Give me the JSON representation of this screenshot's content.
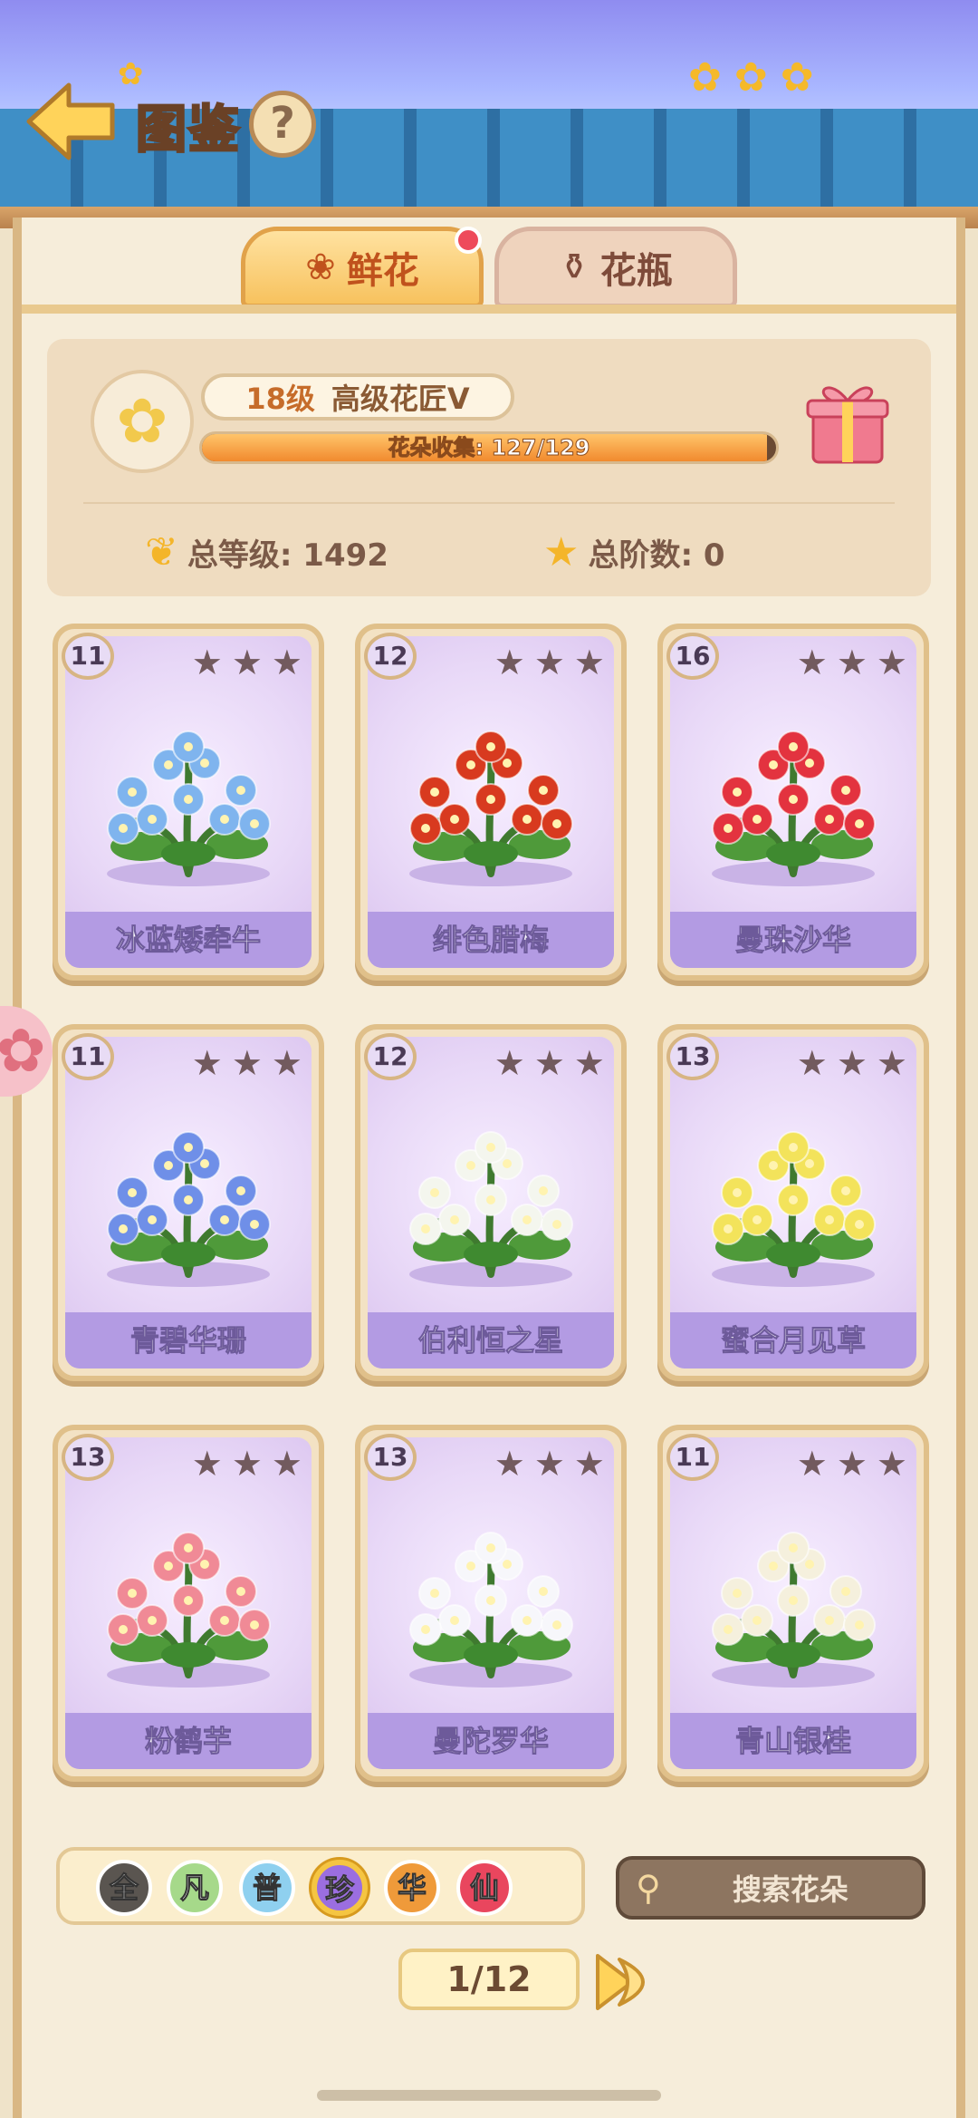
{
  "header": {
    "title": "图鉴",
    "help_label": "?"
  },
  "tabs": [
    {
      "label": "鲜花",
      "icon": "rose-icon",
      "active": true,
      "has_notification": true
    },
    {
      "label": "花瓶",
      "icon": "vase-icon",
      "active": false
    }
  ],
  "profile": {
    "level": "18级",
    "rank": "高级花匠Ⅴ",
    "collection_label": "花朵收集: 127/129",
    "collected": 127,
    "total": 129,
    "total_level": "总等级: 1492",
    "total_tier": "总阶数: 0"
  },
  "cards": [
    {
      "level": "11",
      "name": "冰蓝矮牵牛",
      "stars": 0,
      "max_stars": 3,
      "plant_color": "#7fb4ee"
    },
    {
      "level": "12",
      "name": "绯色腊梅",
      "stars": 0,
      "max_stars": 3,
      "plant_color": "#d83a1f"
    },
    {
      "level": "16",
      "name": "曼珠沙华",
      "stars": 0,
      "max_stars": 3,
      "plant_color": "#e3333f"
    },
    {
      "level": "11",
      "name": "青碧华珊",
      "stars": 0,
      "max_stars": 3,
      "plant_color": "#6f8fe8"
    },
    {
      "level": "12",
      "name": "伯利恒之星",
      "stars": 0,
      "max_stars": 3,
      "plant_color": "#f4f6ee"
    },
    {
      "level": "13",
      "name": "蜜合月见草",
      "stars": 0,
      "max_stars": 3,
      "plant_color": "#f3e35b"
    },
    {
      "level": "13",
      "name": "粉鹤芋",
      "stars": 0,
      "max_stars": 3,
      "plant_color": "#f08a96"
    },
    {
      "level": "13",
      "name": "曼陀罗华",
      "stars": 0,
      "max_stars": 3,
      "plant_color": "#f7f7fb"
    },
    {
      "level": "11",
      "name": "青山银桂",
      "stars": 0,
      "max_stars": 3,
      "plant_color": "#f5f0dd"
    }
  ],
  "filters": [
    {
      "label": "全",
      "color": "#5a5550",
      "selected": false
    },
    {
      "label": "凡",
      "color": "#a6d98a",
      "selected": false
    },
    {
      "label": "普",
      "color": "#8fd0ef",
      "selected": false
    },
    {
      "label": "珍",
      "color": "#9b6ee0",
      "selected": true
    },
    {
      "label": "华",
      "color": "#ef9a3a",
      "selected": false
    },
    {
      "label": "仙",
      "color": "#e9465e",
      "selected": false
    }
  ],
  "search": {
    "placeholder": "搜索花朵"
  },
  "pagination": {
    "label": "1/12"
  },
  "colors": {
    "accent": "#f18a2e",
    "card_name_bg": "#b39be3",
    "star_empty": "#725a5e"
  }
}
